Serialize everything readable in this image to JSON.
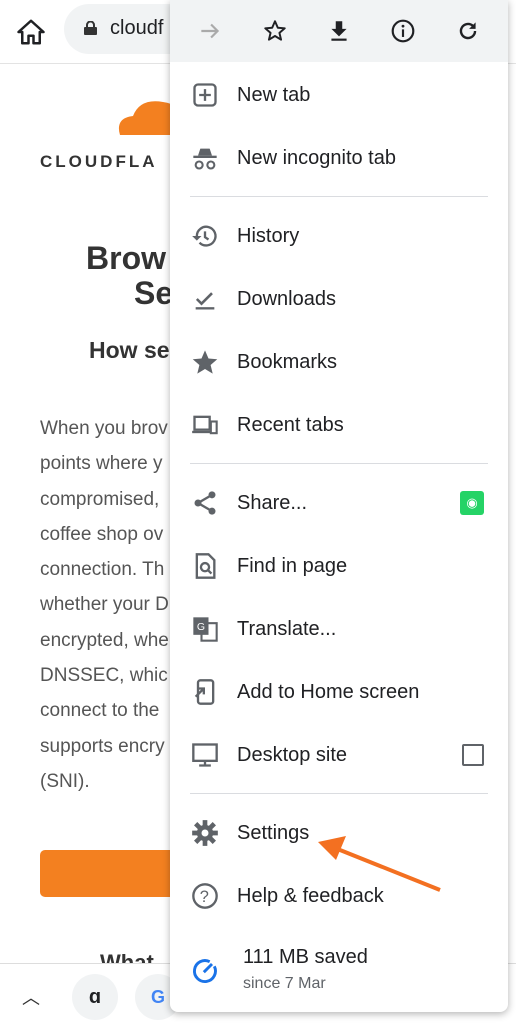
{
  "toolbar": {
    "url": "cloudf"
  },
  "page": {
    "logo_text": "CLOUDFLA",
    "heading_line1": "Brow",
    "heading_line2": "Se",
    "subheading": "How se",
    "paragraph_lines": [
      "When you brov",
      "points where y",
      "compromised,",
      "coffee shop ov",
      "connection. Th",
      "whether your D",
      "encrypted, whe",
      "DNSSEC, whic",
      "connect to the",
      "supports encry",
      "(SNI)."
    ],
    "bottom_heading": "What"
  },
  "menu": {
    "items": [
      {
        "label": "New tab",
        "icon": "plus-square-icon"
      },
      {
        "label": "New incognito tab",
        "icon": "incognito-icon"
      },
      {
        "label": "History",
        "icon": "history-icon"
      },
      {
        "label": "Downloads",
        "icon": "downloads-icon"
      },
      {
        "label": "Bookmarks",
        "icon": "star-icon"
      },
      {
        "label": "Recent tabs",
        "icon": "devices-icon"
      },
      {
        "label": "Share...",
        "icon": "share-icon"
      },
      {
        "label": "Find in page",
        "icon": "find-icon"
      },
      {
        "label": "Translate...",
        "icon": "translate-icon"
      },
      {
        "label": "Add to Home screen",
        "icon": "add-home-icon"
      },
      {
        "label": "Desktop site",
        "icon": "desktop-icon",
        "checked": false
      },
      {
        "label": "Settings",
        "icon": "gear-icon"
      },
      {
        "label": "Help & feedback",
        "icon": "help-icon"
      }
    ],
    "savings": {
      "title": "111 MB saved",
      "subtitle": "since 7 Mar"
    }
  },
  "colors": {
    "accent": "#f38020",
    "whatsapp": "#25d366",
    "lite_blue": "#1a73e8"
  }
}
